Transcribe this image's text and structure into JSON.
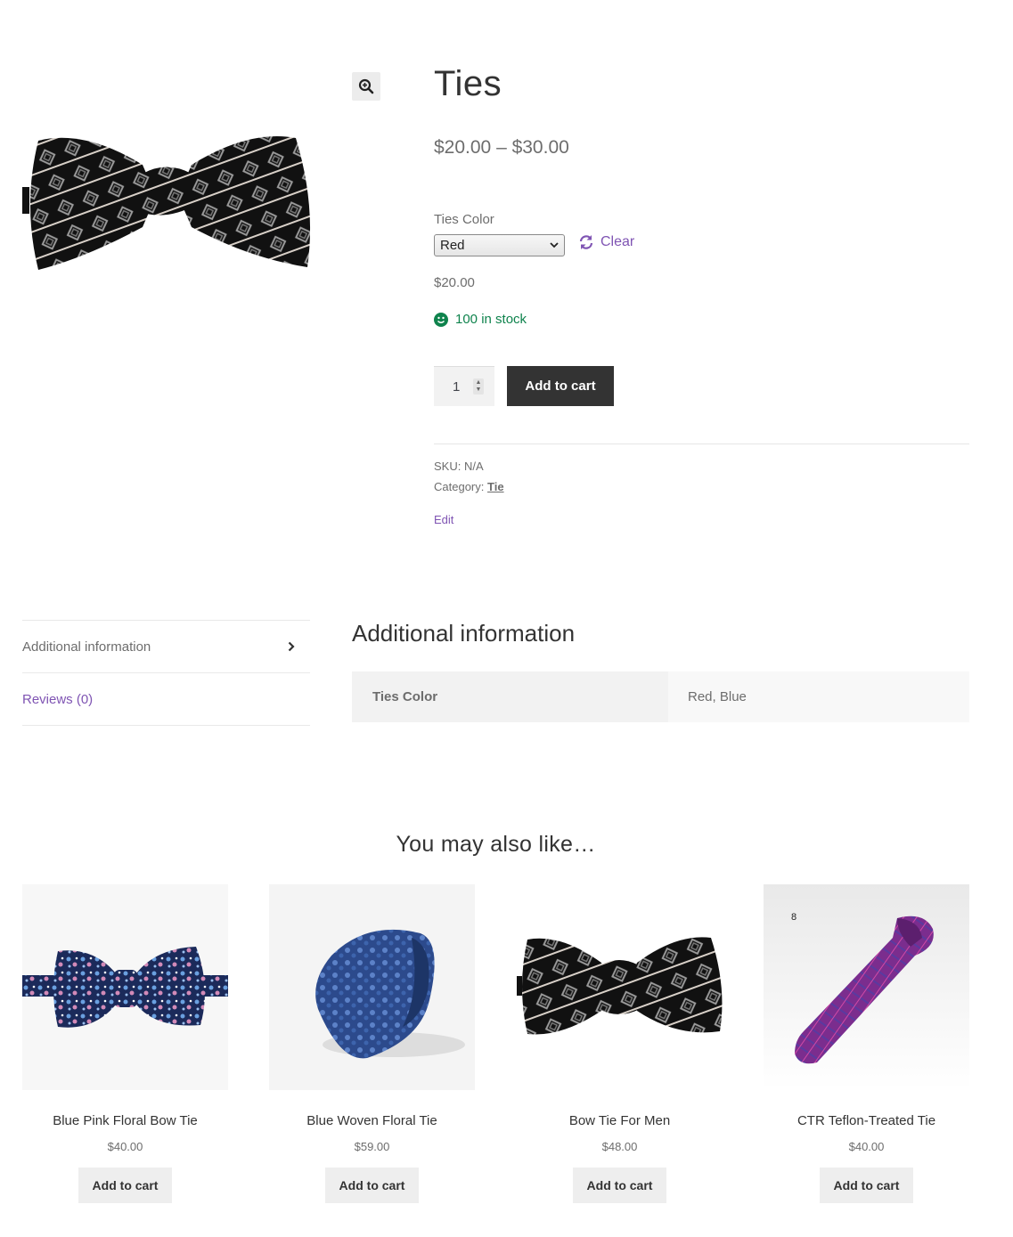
{
  "product": {
    "title": "Ties",
    "price_range": "$20.00 – $30.00",
    "attribute_label": "Ties Color",
    "selected_color": "Red",
    "clear_label": "Clear",
    "variation_price": "$20.00",
    "stock_text": "100 in stock",
    "quantity": "1",
    "add_to_cart_label": "Add to cart",
    "sku_label": "SKU:",
    "sku_value": "N/A",
    "category_label": "Category:",
    "category_value": "Tie",
    "edit_label": "Edit"
  },
  "tabs": [
    {
      "label": "Additional information"
    },
    {
      "label": "Reviews (0)"
    }
  ],
  "additional_info": {
    "heading": "Additional information",
    "rows": [
      {
        "label": "Ties Color",
        "value": "Red, Blue"
      }
    ]
  },
  "related": {
    "heading": "You may also like…",
    "items": [
      {
        "name": "Blue Pink Floral Bow Tie",
        "price": "$40.00",
        "button": "Add to cart"
      },
      {
        "name": "Blue Woven Floral Tie",
        "price": "$59.00",
        "button": "Add to cart"
      },
      {
        "name": "Bow Tie For Men",
        "price": "$48.00",
        "button": "Add to cart"
      },
      {
        "name": "CTR Teflon-Treated Tie",
        "price": "$40.00",
        "button": "Add to cart",
        "image_badge": "8"
      }
    ]
  },
  "colors": {
    "accent": "#7f54b3",
    "stock_green": "#0f834d",
    "button_dark": "#333333",
    "button_light": "#eeeeee"
  },
  "icons": {
    "zoom": "magnifier-plus-icon",
    "clear": "refresh-icon",
    "stock": "smile-icon",
    "tab_arrow": "chevron-right-icon"
  }
}
